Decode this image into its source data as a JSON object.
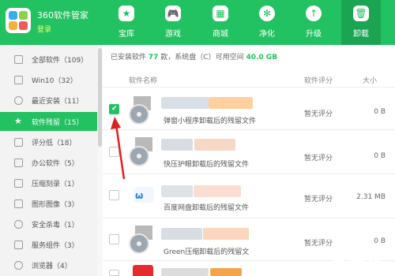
{
  "app": {
    "title": "360软件管家",
    "login": "登录"
  },
  "nav": [
    {
      "label": "宝库",
      "icon": "star-icon"
    },
    {
      "label": "游戏",
      "icon": "gamepad-icon"
    },
    {
      "label": "商城",
      "icon": "store-icon"
    },
    {
      "label": "净化",
      "icon": "purify-icon"
    },
    {
      "label": "升级",
      "icon": "upgrade-icon"
    },
    {
      "label": "卸载",
      "icon": "trash-icon"
    }
  ],
  "sidebar": [
    {
      "label": "全部软件（109）"
    },
    {
      "label": "Win10（32）"
    },
    {
      "label": "最近安装（11）"
    },
    {
      "label": "软件残留（15）"
    },
    {
      "label": "评分低（18）"
    },
    {
      "label": "办公软件（5）"
    },
    {
      "label": "压缩刻录（1）"
    },
    {
      "label": "图形图像（3）"
    },
    {
      "label": "安全杀毒（1）"
    },
    {
      "label": "服务组件（3）"
    },
    {
      "label": "浏览器（4）"
    }
  ],
  "summary": {
    "prefix": "已安装软件",
    "count": "77",
    "mid": "款，系统盘（C）可用空间",
    "space": "40.0 GB"
  },
  "columns": {
    "name": "软件名称",
    "rating": "软件评分",
    "size": "大小"
  },
  "rows": [
    {
      "desc": "弹窗小程序卸载后的残留文件",
      "rating": "暂无评分",
      "size": "0 B",
      "checked": true
    },
    {
      "desc": "快压护眼卸载后的残留文件",
      "rating": "暂无评分",
      "size": "0 B",
      "checked": false
    },
    {
      "desc": "百度网盘卸载后的残留文件",
      "rating": "暂无评分",
      "size": "2.31 MB",
      "checked": false
    },
    {
      "desc": "Green压缩卸载后的残留文",
      "rating": "暂无评分",
      "size": "0 B",
      "checked": false
    }
  ],
  "watermark": "神奇下载",
  "colors": {
    "brand": "#22c161",
    "accent_yellow": "#e9ff6d",
    "arrow": "#e02020"
  }
}
